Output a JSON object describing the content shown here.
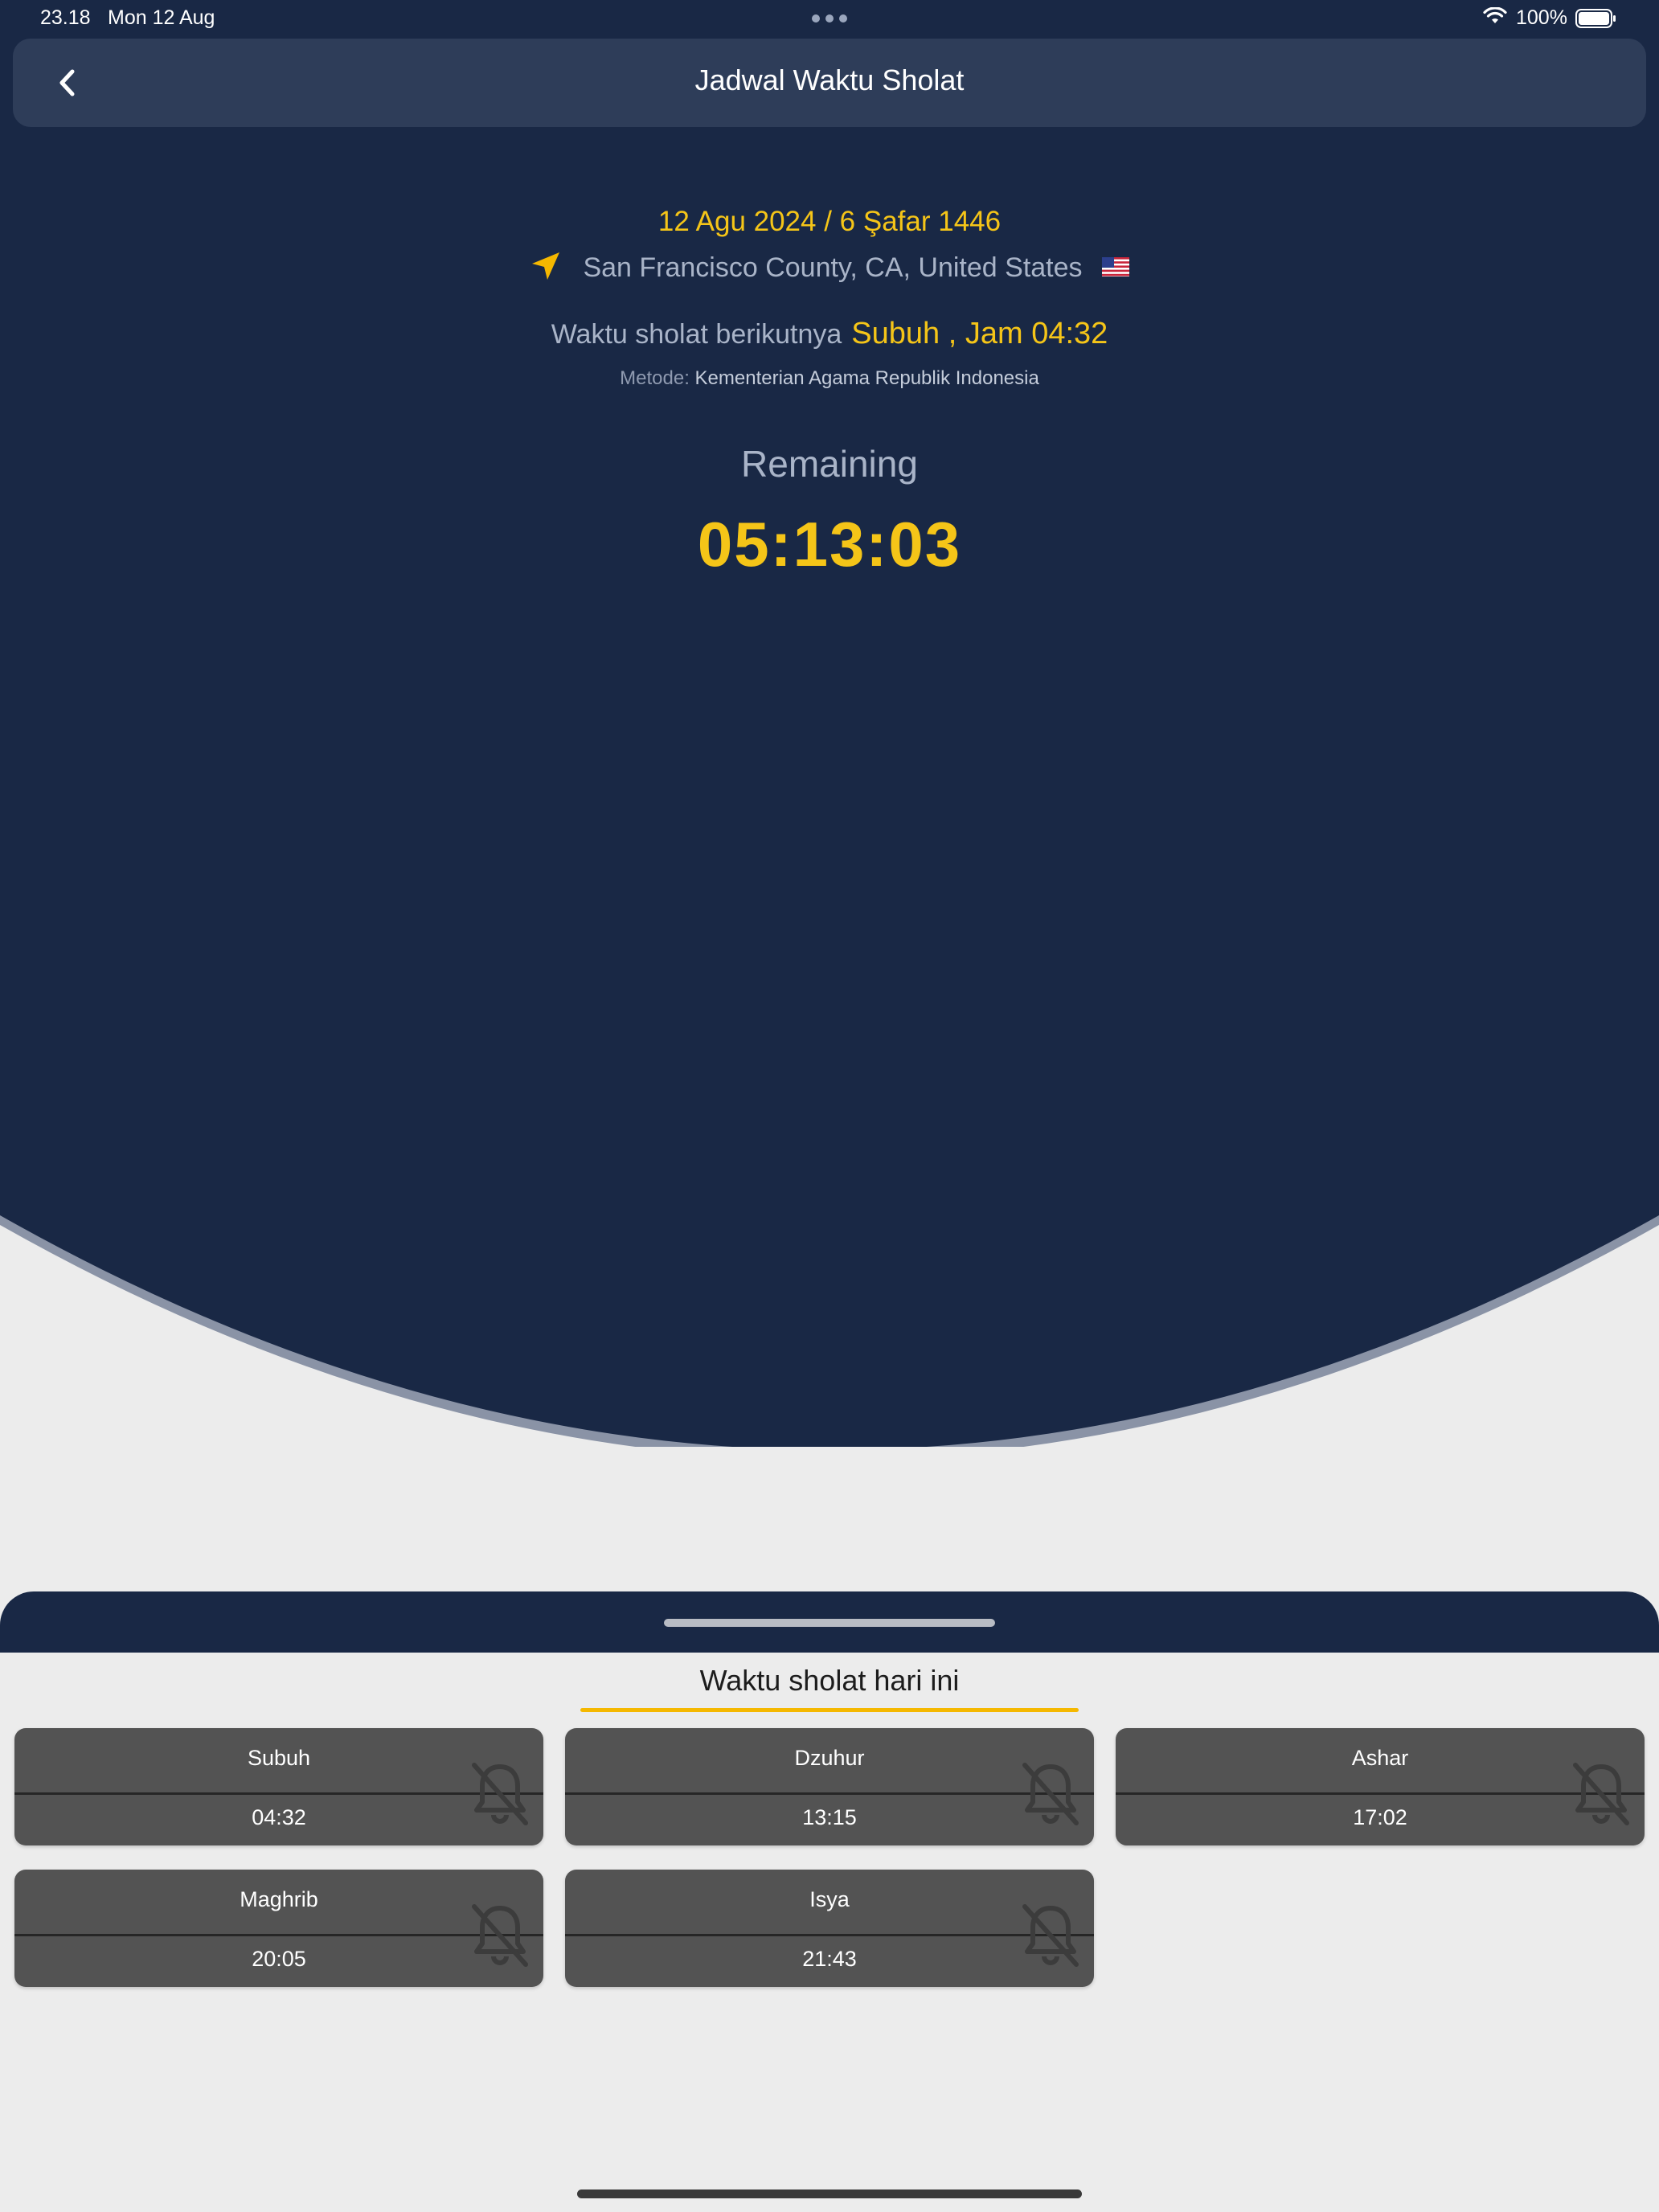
{
  "status_bar": {
    "time": "23.18",
    "date": "Mon 12 Aug",
    "battery": "100%"
  },
  "nav": {
    "title": "Jadwal Waktu Sholat"
  },
  "header": {
    "date": "12 Agu 2024 / 6 Şafar 1446",
    "location": "San Francisco County, CA, United States",
    "next_prefix": "Waktu sholat berikutnya",
    "next_value": "Subuh , Jam 04:32",
    "method_label": "Metode:",
    "method_value": "Kementerian Agama Republik Indonesia",
    "remaining_label": "Remaining",
    "countdown": "05:13:03"
  },
  "colors": {
    "navy": "#192845",
    "accent": "#f5c518",
    "card": "#535353",
    "sheet_bg": "#ececec"
  },
  "icons": {
    "back": "chevron-left-icon",
    "location": "location-arrow-icon",
    "flag": "us-flag-icon",
    "notification_off": "bell-slash-icon"
  },
  "today": {
    "title": "Waktu sholat hari ini",
    "prayers": [
      {
        "name": "Subuh",
        "time": "04:32"
      },
      {
        "name": "Dzuhur",
        "time": "13:15"
      },
      {
        "name": "Ashar",
        "time": "17:02"
      },
      {
        "name": "Maghrib",
        "time": "20:05"
      },
      {
        "name": "Isya",
        "time": "21:43"
      }
    ]
  }
}
